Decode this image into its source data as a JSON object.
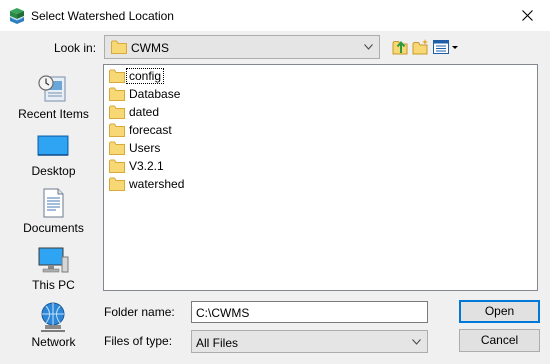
{
  "window": {
    "title": "Select Watershed Location",
    "icon": "watershed-app-icon",
    "close_icon": "close-icon"
  },
  "lookin": {
    "label": "Look in:",
    "value": "CWMS"
  },
  "toolbar": {
    "up_icon": "up-folder-icon",
    "new_folder_icon": "new-folder-icon",
    "view_menu_icon": "view-menu-icon"
  },
  "places": [
    {
      "label": "Recent Items",
      "icon": "recent-items-icon"
    },
    {
      "label": "Desktop",
      "icon": "desktop-icon"
    },
    {
      "label": "Documents",
      "icon": "documents-icon"
    },
    {
      "label": "This PC",
      "icon": "computer-icon"
    },
    {
      "label": "Network",
      "icon": "network-icon"
    }
  ],
  "files": [
    {
      "name": "config",
      "focused": true
    },
    {
      "name": "Database"
    },
    {
      "name": "dated"
    },
    {
      "name": "forecast"
    },
    {
      "name": "Users"
    },
    {
      "name": "V3.2.1"
    },
    {
      "name": "watershed"
    }
  ],
  "folder_name": {
    "label": "Folder name:",
    "value": "C:\\CWMS"
  },
  "files_of_type": {
    "label": "Files of type:",
    "value": "All Files"
  },
  "buttons": {
    "open": "Open",
    "cancel": "Cancel"
  },
  "colors": {
    "folder": "#f8d775",
    "accent": "#0078d7",
    "window_bg": "#f0f0f0"
  }
}
